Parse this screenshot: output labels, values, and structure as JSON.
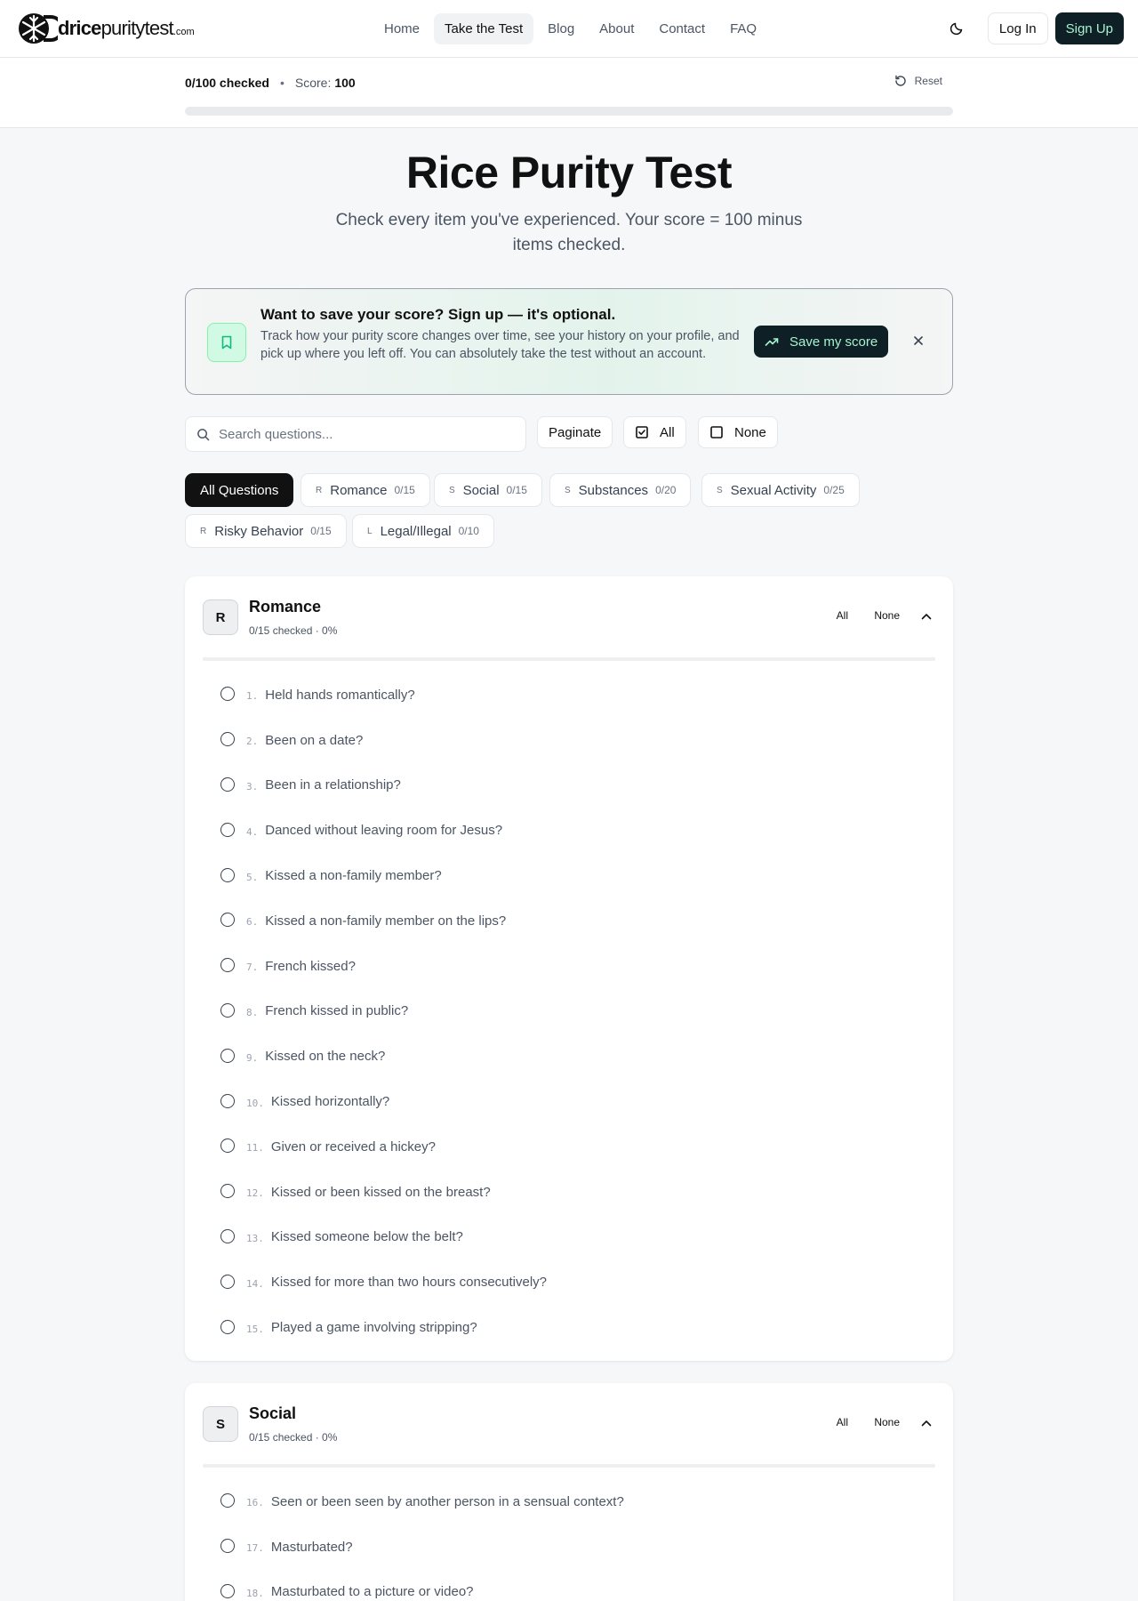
{
  "brand": {
    "part1": "drice",
    "part2": "puritytest",
    "tld": ".com"
  },
  "nav": {
    "links": [
      "Home",
      "Take the Test",
      "Blog",
      "About",
      "Contact",
      "FAQ"
    ],
    "login": "Log In",
    "signup": "Sign Up"
  },
  "status": {
    "checked": "0/100 checked",
    "score_label": "Score:",
    "score_value": "100",
    "reset": "Reset",
    "progress_fraction": 0
  },
  "hero": {
    "title": "Rice Purity Test",
    "subtitle": "Check every item you've experienced. Your score = 100 minus items checked."
  },
  "banner": {
    "title": "Want to save your score? Sign up — it's optional.",
    "text": "Track how your purity score changes over time, see your history on your profile, and pick up where you left off. You can absolutely take the test without an account.",
    "button": "Save my score"
  },
  "controls": {
    "search_placeholder": "Search questions...",
    "paginate": "Paginate",
    "all": "All",
    "none": "None"
  },
  "categories": [
    {
      "label": "All Questions",
      "letter": "",
      "count": ""
    },
    {
      "label": "Romance",
      "letter": "R",
      "count": "0/15"
    },
    {
      "label": "Social",
      "letter": "S",
      "count": "0/15"
    },
    {
      "label": "Substances",
      "letter": "S",
      "count": "0/20"
    },
    {
      "label": "Sexual Activity",
      "letter": "S",
      "count": "0/25"
    },
    {
      "label": "Risky Behavior",
      "letter": "R",
      "count": "0/15"
    },
    {
      "label": "Legal/Illegal",
      "letter": "L",
      "count": "0/10"
    }
  ],
  "sections": [
    {
      "badge": "R",
      "title": "Romance",
      "meta": "0/15 checked · 0%",
      "all": "All",
      "none": "None",
      "questions": [
        {
          "num": "1.",
          "text": "Held hands romantically?"
        },
        {
          "num": "2.",
          "text": "Been on a date?"
        },
        {
          "num": "3.",
          "text": "Been in a relationship?"
        },
        {
          "num": "4.",
          "text": "Danced without leaving room for Jesus?"
        },
        {
          "num": "5.",
          "text": "Kissed a non-family member?"
        },
        {
          "num": "6.",
          "text": "Kissed a non-family member on the lips?"
        },
        {
          "num": "7.",
          "text": "French kissed?"
        },
        {
          "num": "8.",
          "text": "French kissed in public?"
        },
        {
          "num": "9.",
          "text": "Kissed on the neck?"
        },
        {
          "num": "10.",
          "text": "Kissed horizontally?"
        },
        {
          "num": "11.",
          "text": "Given or received a hickey?"
        },
        {
          "num": "12.",
          "text": "Kissed or been kissed on the breast?"
        },
        {
          "num": "13.",
          "text": "Kissed someone below the belt?"
        },
        {
          "num": "14.",
          "text": "Kissed for more than two hours consecutively?"
        },
        {
          "num": "15.",
          "text": "Played a game involving stripping?"
        }
      ]
    },
    {
      "badge": "S",
      "title": "Social",
      "meta": "0/15 checked · 0%",
      "all": "All",
      "none": "None",
      "questions": [
        {
          "num": "16.",
          "text": "Seen or been seen by another person in a sensual context?"
        },
        {
          "num": "17.",
          "text": "Masturbated?"
        },
        {
          "num": "18.",
          "text": "Masturbated to a picture or video?"
        }
      ]
    }
  ]
}
